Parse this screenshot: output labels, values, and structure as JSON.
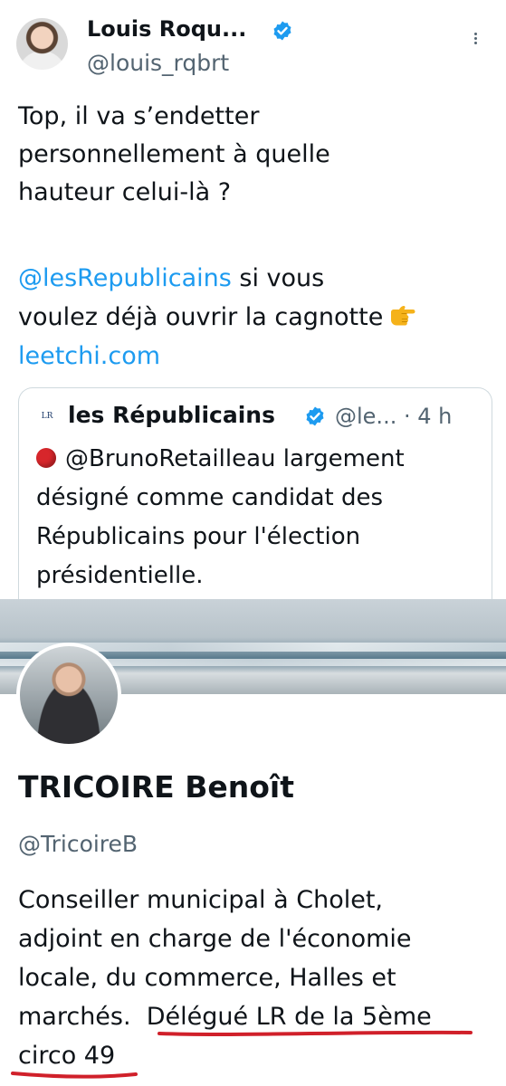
{
  "tweet": {
    "author_name": "Louis Roqu...",
    "author_handle": "@louis_rqbrt",
    "lines": [
      "Top, il va s’endetter",
      "personnellement à quelle",
      "hauteur celui-là ?"
    ],
    "mention": "@lesRepublicains",
    "mention_suffix": " si vous",
    "line5": "voulez déjà ouvrir la cagnotte",
    "emoji_name": "backhand-index-pointing-right",
    "link": "leetchi.com"
  },
  "quote": {
    "avatar_text": "LR",
    "name": "les Républicains",
    "handle": "@le...",
    "time": "· 4 h",
    "mention": "@BrunoRetailleau",
    "line1_rest": " largement",
    "lines": [
      "désigné comme candidat des",
      "Républicains pour l'élection",
      "présidentielle."
    ]
  },
  "profile": {
    "name": "TRICOIRE Benoît",
    "handle": "@TricoireB",
    "bio_lines": [
      "Conseiller municipal à Cholet,",
      "adjoint en charge de l'économie",
      "locale, du commerce, Halles et"
    ],
    "bio_line4_a": "marchés.",
    "bio_line4_b": "Délégué LR de la 5ème",
    "bio_line5": "circo 49"
  },
  "colors": {
    "link": "#1d9bf0",
    "verified": "#1d9bf0",
    "text": "#0f1419",
    "secondary": "#536471",
    "annotation": "#d0202a"
  }
}
